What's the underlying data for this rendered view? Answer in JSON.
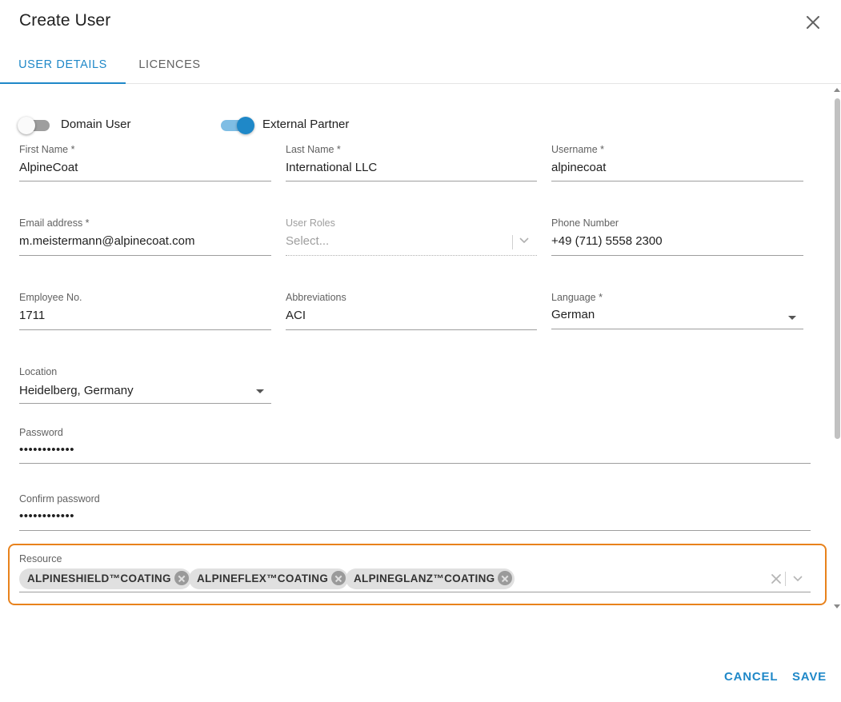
{
  "dialog": {
    "title": "Create User",
    "close_icon": "close-icon"
  },
  "tabs": [
    {
      "label": "USER DETAILS",
      "active": true
    },
    {
      "label": "LICENCES",
      "active": false
    }
  ],
  "toggles": {
    "domain_user": {
      "label": "Domain User",
      "checked": false
    },
    "external_partner": {
      "label": "External Partner",
      "checked": true
    }
  },
  "fields": {
    "first_name": {
      "label": "First Name *",
      "value": "AlpineCoat"
    },
    "last_name": {
      "label": "Last Name *",
      "value": "International LLC"
    },
    "username": {
      "label": "Username *",
      "value": "alpinecoat"
    },
    "email": {
      "label": "Email address *",
      "value": "m.meistermann@alpinecoat.com"
    },
    "user_roles": {
      "label": "User Roles",
      "placeholder": "Select...",
      "disabled": true
    },
    "phone": {
      "label": "Phone Number",
      "value": "+49 (711) 5558 2300"
    },
    "employee_no": {
      "label": "Employee No.",
      "value": "1711"
    },
    "abbreviations": {
      "label": "Abbreviations",
      "value": "ACI"
    },
    "language": {
      "label": "Language *",
      "value": "German"
    },
    "location": {
      "label": "Location",
      "value": "Heidelberg, Germany"
    },
    "password": {
      "label": "Password",
      "value": "••••••••••••"
    },
    "confirm_password": {
      "label": "Confirm password",
      "value": "••••••••••••"
    }
  },
  "resource": {
    "label": "Resource",
    "chips": [
      "ALPINESHIELD™COATING",
      "ALPINEFLEX™COATING",
      "ALPINEGLANZ™COATING"
    ],
    "highlight_color": "#e8821c"
  },
  "footer": {
    "cancel_label": "CANCEL",
    "save_label": "SAVE"
  },
  "colors": {
    "accent": "#1f88c8"
  }
}
